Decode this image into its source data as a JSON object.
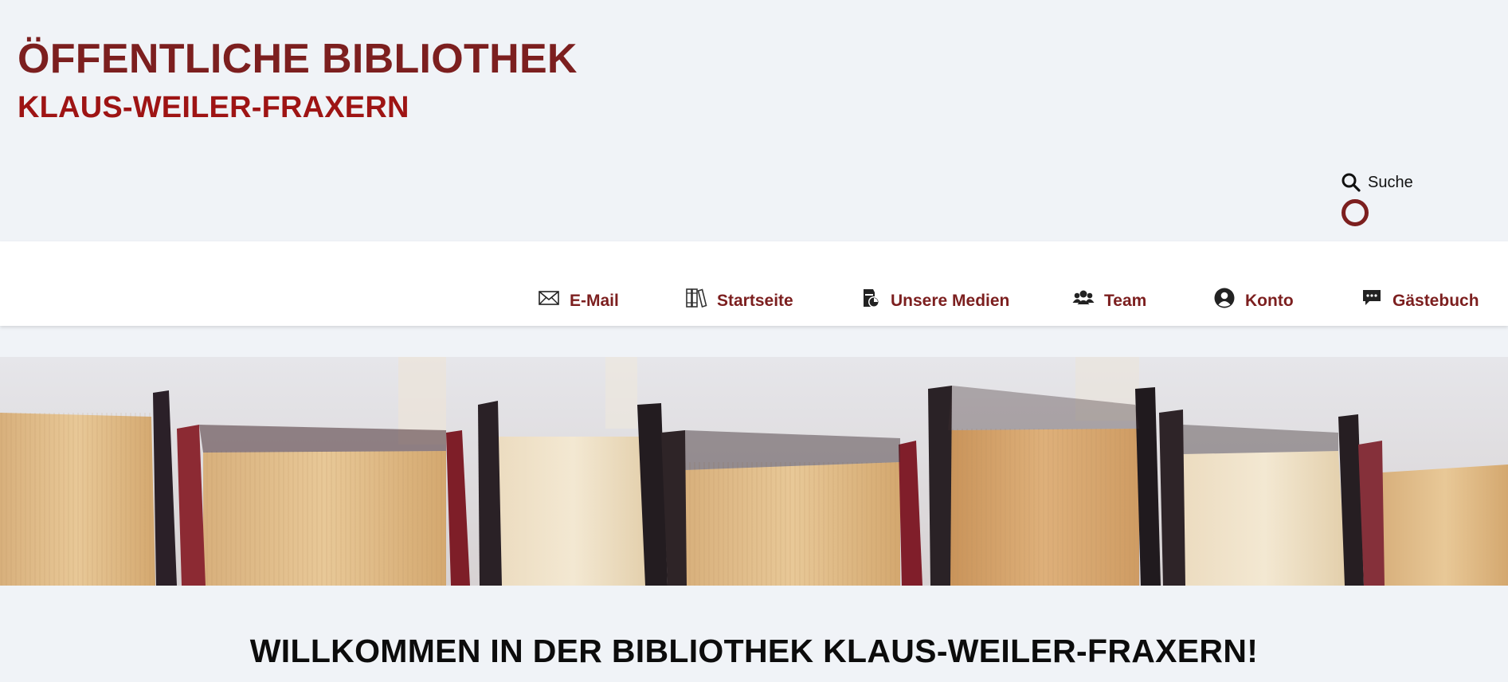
{
  "header": {
    "title": "ÖFFENTLICHE BIBLIOTHEK",
    "subtitle": "KLAUS-WEILER-FRAXERN",
    "search_label": "Suche"
  },
  "nav": {
    "items": [
      {
        "label": "E-Mail",
        "icon": "envelope-icon"
      },
      {
        "label": "Startseite",
        "icon": "books-icon"
      },
      {
        "label": "Unsere Medien",
        "icon": "media-icon"
      },
      {
        "label": "Team",
        "icon": "users-icon"
      },
      {
        "label": "Konto",
        "icon": "user-circle-icon"
      },
      {
        "label": "Gästebuch",
        "icon": "comments-icon"
      }
    ]
  },
  "banner": {
    "image": "books-photo"
  },
  "main": {
    "welcome": "WILLKOMMEN IN DER BIBLIOTHEK KLAUS-WEILER-FRAXERN!"
  },
  "colors": {
    "brand": "#7c1f1f",
    "brand_bright": "#9e1414",
    "page_bg": "#f0f3f7",
    "nav_bg": "#ffffff"
  }
}
